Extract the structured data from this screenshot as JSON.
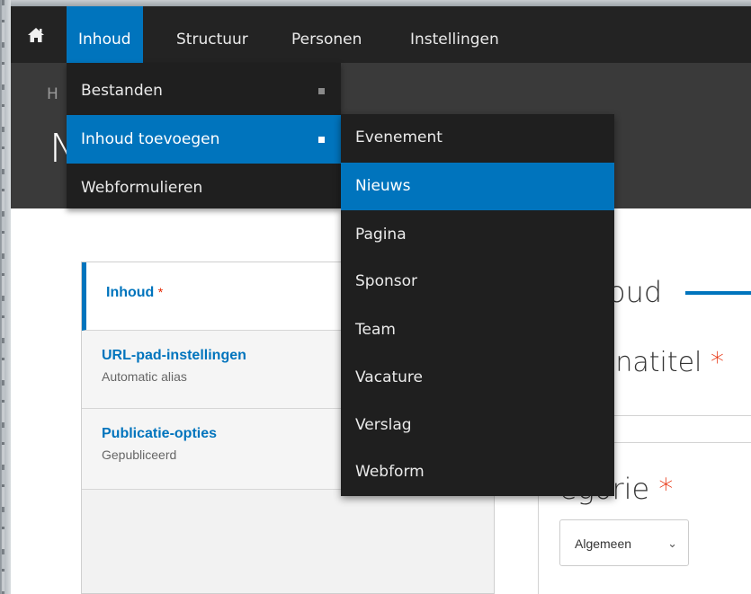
{
  "toolbar": {
    "home_icon": "home-icon",
    "items": [
      {
        "label": "Inhoud",
        "active": true
      },
      {
        "label": "Structuur",
        "active": false
      },
      {
        "label": "Personen",
        "active": false
      },
      {
        "label": "Instellingen",
        "active": false
      }
    ]
  },
  "header": {
    "breadcrumb_fragment": "H",
    "title_fragment": "N"
  },
  "inhoud_menu": {
    "items": [
      {
        "label": "Bestanden",
        "has_submenu": true
      },
      {
        "label": "Inhoud toevoegen",
        "has_submenu": true,
        "active": true
      },
      {
        "label": "Webformulieren",
        "has_submenu": false
      }
    ]
  },
  "add_content_menu": {
    "items": [
      {
        "label": "Evenement"
      },
      {
        "label": "Nieuws",
        "active": true
      },
      {
        "label": "Pagina"
      },
      {
        "label": "Sponsor"
      },
      {
        "label": "Team"
      },
      {
        "label": "Vacature"
      },
      {
        "label": "Verslag"
      },
      {
        "label": "Webform"
      }
    ]
  },
  "vertical_tabs": [
    {
      "title": "Inhoud",
      "required_marker": "*",
      "summary": "",
      "selected": true
    },
    {
      "title": "URL-pad-instellingen",
      "summary": "Automatic alias"
    },
    {
      "title": "Publicatie-opties",
      "summary": "Gepubliceerd"
    }
  ],
  "form": {
    "section_title_fragment": "oud",
    "page_title_label_fragment": "inatitel",
    "required_marker": "*",
    "category_label_fragment": "egorie",
    "category_select_value": "Algemeen"
  },
  "colors": {
    "accent": "#0074bd",
    "toolbar_bg": "#232323",
    "menu_bg": "#1f1f1f",
    "required": "#e62600"
  }
}
